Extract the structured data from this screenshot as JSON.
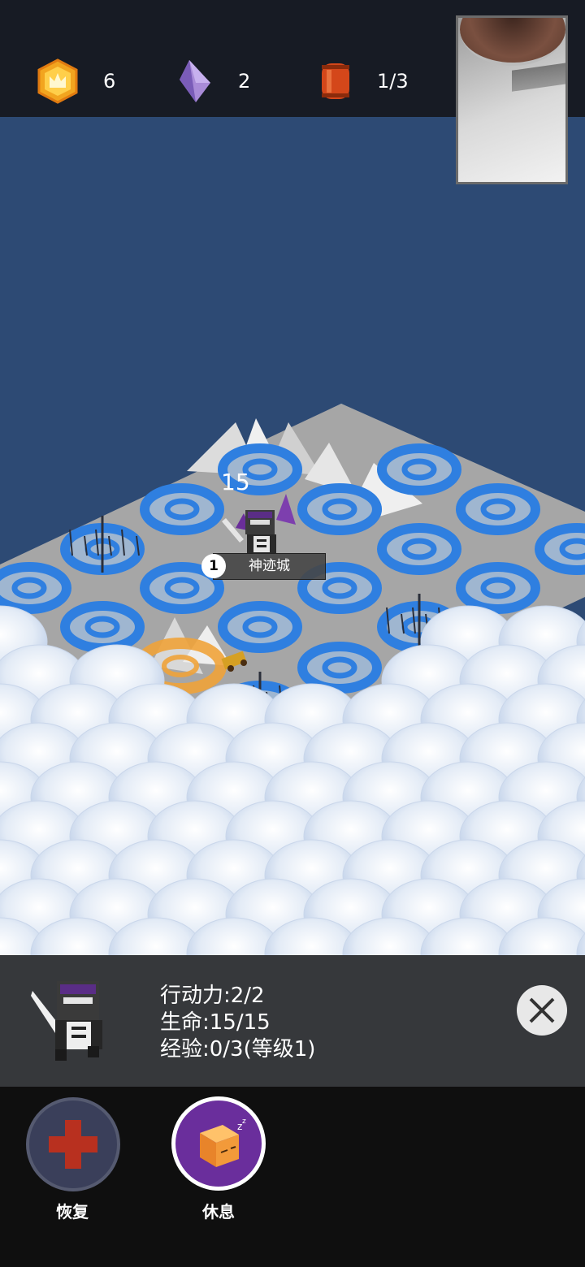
{
  "resources": [
    {
      "name": "gold",
      "icon": "hexagon-crown-icon",
      "value": "6"
    },
    {
      "name": "crystal",
      "icon": "purple-crystal-icon",
      "value": "2"
    },
    {
      "name": "barrel",
      "icon": "barrel-icon",
      "value": "1/3"
    }
  ],
  "map": {
    "hp_float": "15",
    "city": {
      "level": "1",
      "name": "神迹城"
    }
  },
  "unit_panel": {
    "action_points": "行动力:2/2",
    "life": "生命:15/15",
    "exp": "经验:0/3(等级1)"
  },
  "actions": [
    {
      "label": "恢复",
      "icon": "red-cross-icon"
    },
    {
      "label": "休息",
      "icon": "sleeping-cube-icon"
    }
  ],
  "colors": {
    "background": "#2d4a74",
    "topbar": "#171b24",
    "tile": "#a8a8a8",
    "ring": "#2f7fe0",
    "cloud": "#e9f0fa"
  }
}
